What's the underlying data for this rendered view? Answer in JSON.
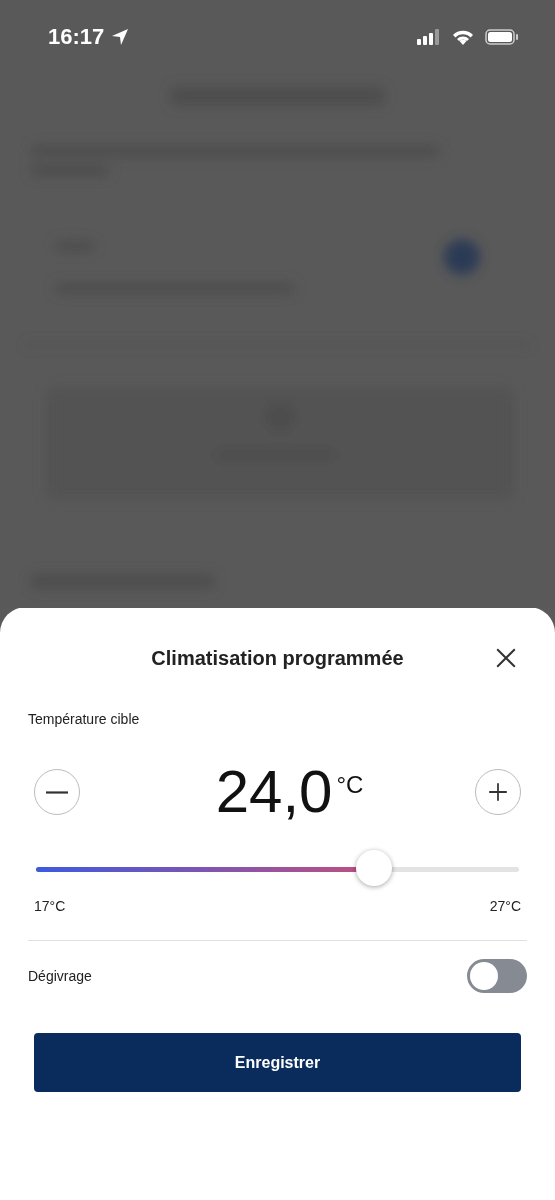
{
  "status_bar": {
    "time": "16:17"
  },
  "sheet": {
    "title": "Climatisation programmée",
    "target": {
      "label": "Température cible",
      "value": "24,0",
      "unit": "°C",
      "level": 0.7,
      "min_label": "17°C",
      "max_label": "27°C"
    },
    "defrost": {
      "label": "Dégivrage",
      "on": false
    },
    "save_button": "Enregistrer"
  }
}
